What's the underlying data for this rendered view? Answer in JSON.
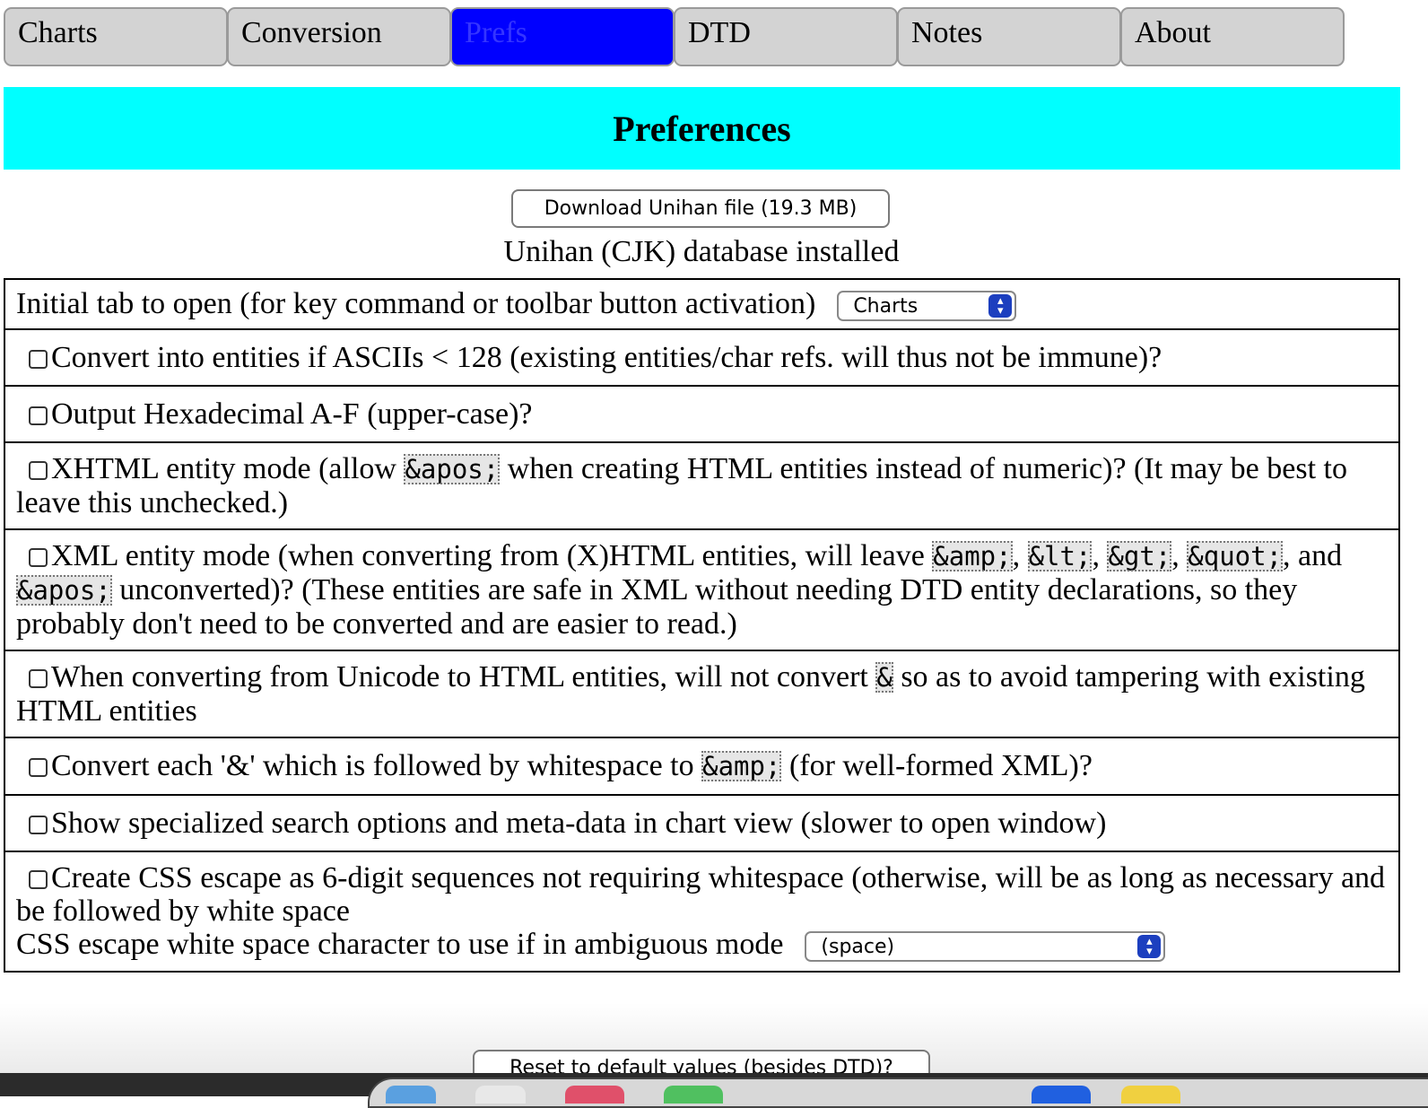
{
  "tabs": [
    {
      "label": "Charts",
      "active": false
    },
    {
      "label": "Conversion",
      "active": false
    },
    {
      "label": "Prefs",
      "active": true
    },
    {
      "label": "DTD",
      "active": false
    },
    {
      "label": "Notes",
      "active": false
    },
    {
      "label": "About",
      "active": false
    }
  ],
  "banner": {
    "title": "Preferences"
  },
  "download_button": "Download Unihan file (19.3 MB)",
  "status_text": "Unihan (CJK) database installed",
  "rows": {
    "initial_tab": {
      "label": "Initial tab to open (for key command or toolbar button activation)",
      "selected": "Charts"
    },
    "ascii": "Convert into entities if ASCIIs < 128 (existing entities/char refs. will thus not be immune)?",
    "hex": "Output Hexadecimal A-F (upper-case)?",
    "xhtml": {
      "pre": "XHTML entity mode (allow ",
      "code": "&apos;",
      "post": " when creating HTML entities instead of numeric)? (It may be best to leave this unchecked.)"
    },
    "xml": {
      "pre": "XML entity mode (when converting from (X)HTML entities, will leave ",
      "codes": [
        "&amp;",
        "&lt;",
        "&gt;",
        "&quot;",
        "&apos;"
      ],
      "sep": ", ",
      "sep_last": ", and ",
      "post": " unconverted)? (These entities are safe in XML without needing DTD entity declarations, so they probably don't need to be converted and are easier to read.)"
    },
    "unicode": {
      "pre": "When converting from Unicode to HTML entities, will not convert ",
      "code": "&",
      "post": " so as to avoid tampering with existing HTML entities"
    },
    "amp": {
      "pre": "Convert each '&' which is followed by whitespace to ",
      "code": "&amp;",
      "post": " (for well-formed XML)?"
    },
    "search": "Show specialized search options and meta-data in chart view (slower to open window)",
    "css": {
      "label": "Create CSS escape as 6-digit sequences not requiring whitespace (otherwise, will be as long as necessary and be followed by white space",
      "ws_label": "CSS escape white space character to use if in ambiguous mode",
      "ws_selected": "(space)"
    }
  },
  "reset_button": "Reset to default values (besides DTD)?",
  "icons": {
    "checkbox": "checkbox-icon",
    "select_arrows": "select-arrows-icon"
  }
}
